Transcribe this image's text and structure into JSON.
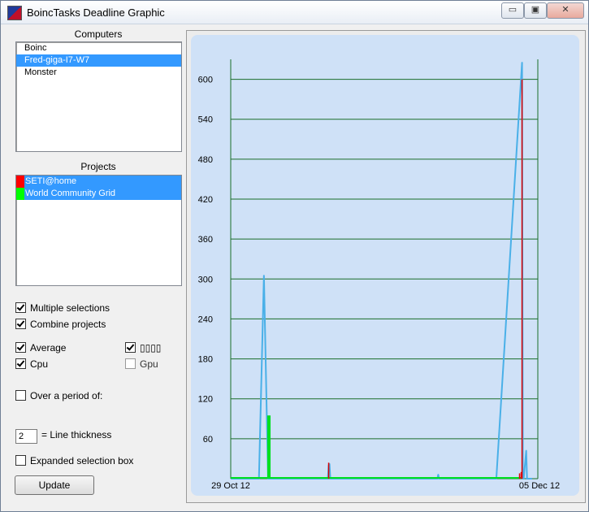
{
  "window": {
    "title": "BoincTasks Deadline Graphic",
    "controls": [
      "▭",
      "▣",
      "✕"
    ]
  },
  "computers": {
    "label": "Computers",
    "items": [
      {
        "name": "Boinc",
        "selected": false
      },
      {
        "name": "Fred-giga-I7-W7",
        "selected": true
      },
      {
        "name": "Monster",
        "selected": false
      }
    ]
  },
  "projects": {
    "label": "Projects",
    "items": [
      {
        "name": "SETI@home",
        "color": "#ff0000",
        "selected": true
      },
      {
        "name": "World Community Grid",
        "color": "#00ff00",
        "selected": true
      }
    ]
  },
  "options": {
    "multiple_selections": {
      "label": "Multiple selections",
      "checked": true
    },
    "combine_projects": {
      "label": "Combine projects",
      "checked": true
    },
    "average": {
      "label": "Average",
      "checked": true
    },
    "unknown": {
      "label": "▯▯▯▯",
      "checked": true
    },
    "cpu": {
      "label": "Cpu",
      "checked": true
    },
    "gpu": {
      "label": "Gpu",
      "checked": false
    },
    "period": {
      "label": "Over a period of:",
      "checked": false
    },
    "line_thickness": {
      "value": "2",
      "label": "= Line thickness"
    },
    "expanded": {
      "label": "Expanded selection box",
      "checked": false
    },
    "update_label": "Update"
  },
  "chart_data": {
    "type": "line",
    "x_tick_labels": [
      "29 Oct 12",
      "05 Dec 12"
    ],
    "y_ticks": [
      60,
      120,
      180,
      240,
      300,
      360,
      420,
      480,
      540,
      600
    ],
    "ylim": [
      0,
      630
    ],
    "xlim": [
      0,
      37
    ],
    "grid": true,
    "series": [
      {
        "color": "#4ab0e8",
        "x": [
          0,
          3.4,
          4.0,
          4.5,
          11.7,
          11.8,
          11.9,
          12.0,
          24.9,
          25.0,
          25.1,
          27.9,
          31.0,
          32.0,
          35.1,
          35.2,
          35.3,
          35.6,
          35.7,
          36.3
        ],
        "values": [
          0,
          0,
          305,
          0,
          0,
          20,
          22,
          0,
          0,
          6,
          0,
          0,
          0,
          0,
          625,
          0,
          0,
          42,
          0,
          0
        ]
      },
      {
        "color": "#00e020",
        "x": [
          0,
          4.4,
          4.4,
          4.8,
          4.8,
          32.0,
          35.0
        ],
        "values": [
          0,
          0,
          95,
          95,
          0,
          0,
          0
        ],
        "style": "bars"
      },
      {
        "color": "#e00000",
        "x": [
          11.8,
          35.1,
          34.8,
          35.0
        ],
        "values": [
          24,
          600,
          8,
          10
        ],
        "style": "spikes"
      }
    ]
  }
}
